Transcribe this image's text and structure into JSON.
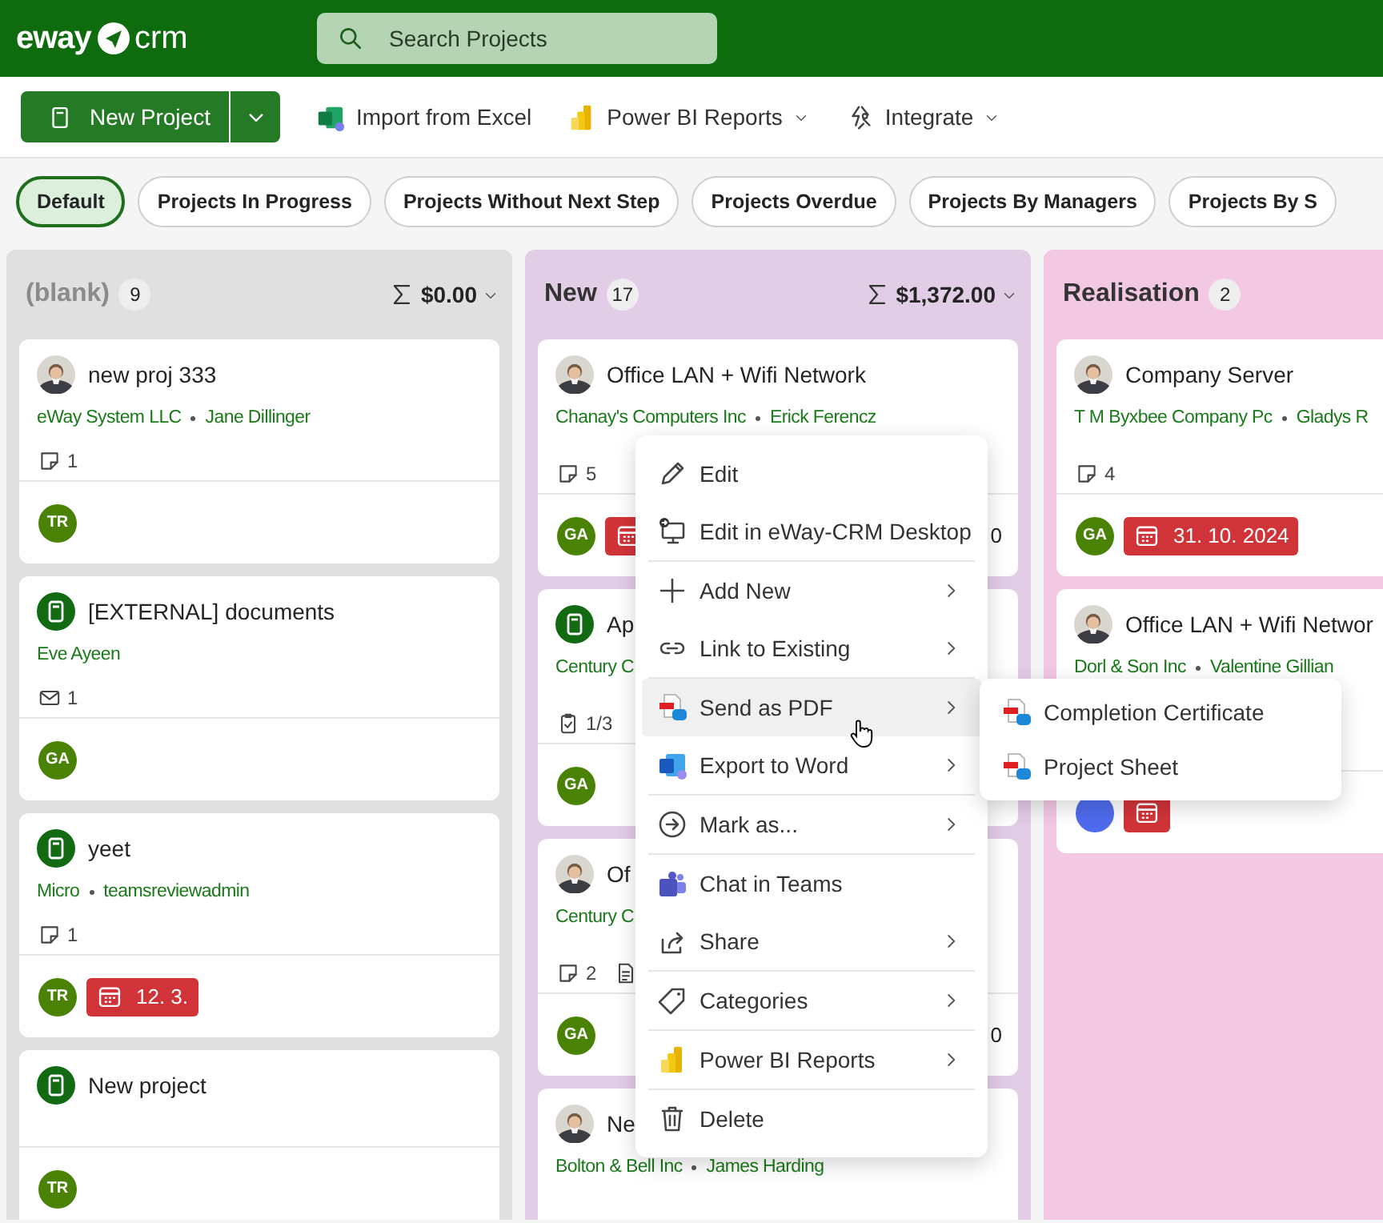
{
  "app": {
    "logo_left": "eway",
    "logo_right": "crm"
  },
  "search": {
    "placeholder": "Search Projects"
  },
  "toolbar": {
    "new_button": "New Project",
    "actions": [
      {
        "label": "Import from Excel",
        "kind": "excel",
        "dropdown": false
      },
      {
        "label": "Power BI Reports",
        "kind": "powerbi",
        "dropdown": true
      },
      {
        "label": "Integrate",
        "kind": "integrate",
        "dropdown": true
      }
    ]
  },
  "filters": [
    {
      "label": "Default",
      "selected": true
    },
    {
      "label": "Projects In Progress",
      "selected": false
    },
    {
      "label": "Projects Without Next Step",
      "selected": false
    },
    {
      "label": "Projects Overdue",
      "selected": false
    },
    {
      "label": "Projects By Managers",
      "selected": false
    },
    {
      "label": "Projects By S",
      "selected": false
    }
  ],
  "columns": [
    {
      "title": "(blank)",
      "muted": true,
      "count": "9",
      "sum": "$0.00",
      "color": "#e0e0e0",
      "cards": [
        {
          "title": "new proj 333",
          "links": [
            "eWay System LLC",
            "Jane Dillinger"
          ],
          "stats": [
            {
              "kind": "note",
              "value": "1"
            }
          ],
          "owner": {
            "initials": "TR",
            "color": "#498205"
          },
          "due_badge": false
        },
        {
          "kind": "project",
          "title": "[EXTERNAL] documents",
          "links": [
            "Eve Ayeen"
          ],
          "stats": [
            {
              "kind": "mail",
              "value": "1"
            }
          ],
          "owner": {
            "initials": "GA",
            "color": "#498205"
          },
          "due_badge": false
        },
        {
          "kind": "project",
          "title": "yeet",
          "links": [
            "Micro",
            "teamsreviewadmin"
          ],
          "stats": [
            {
              "kind": "note",
              "value": "1"
            }
          ],
          "owner": {
            "initials": "TR",
            "color": "#498205"
          },
          "due_badge": true,
          "due": "12. 3."
        },
        {
          "kind": "project",
          "title": "New project",
          "owner": {
            "initials": "TR",
            "color": "#498205"
          },
          "due_badge": false
        }
      ]
    },
    {
      "title": "New",
      "muted": false,
      "count": "17",
      "sum": "$1,372.00",
      "color": "#e2cde6",
      "cards": [
        {
          "title": "Office LAN + Wifi Network",
          "links": [
            "Chanay's Computers Inc",
            "Erick Ferencz"
          ],
          "stats": [
            {
              "kind": "note",
              "value": "5"
            }
          ],
          "owner": {
            "initials": "GA",
            "color": "#498205"
          },
          "due_badge": true,
          "amount": "0"
        },
        {
          "kind": "project",
          "title": "Ap",
          "links": [
            "Century C"
          ],
          "stats": [
            {
              "kind": "task",
              "value": "1/3"
            }
          ],
          "owner": {
            "initials": "GA",
            "color": "#498205"
          },
          "due_badge": false
        },
        {
          "title": "Of",
          "links": [
            "Century C"
          ],
          "stats": [
            {
              "kind": "note",
              "value": "2"
            },
            {
              "kind": "doc"
            }
          ],
          "owner": {
            "initials": "GA",
            "color": "#498205"
          },
          "due_badge": false,
          "amount": "0"
        },
        {
          "title": "Ne",
          "links": [
            "Bolton & Bell Inc",
            "James Harding"
          ]
        }
      ]
    },
    {
      "title": "Realisation",
      "muted": false,
      "count": "2",
      "color": "#f3c8e3",
      "cards": [
        {
          "title": "Company Server",
          "links": [
            "T M Byxbee Company Pc",
            "Gladys R"
          ],
          "stats": [
            {
              "kind": "note",
              "value": "4"
            }
          ],
          "owner": {
            "initials": "GA",
            "color": "#498205"
          },
          "due_badge": true,
          "due": "31. 10. 2024"
        },
        {
          "title": "Office LAN + Wifi Networ",
          "links": [
            "Dorl & Son Inc",
            "Valentine Gillian"
          ],
          "owner": {
            "color": "#4f6bed"
          },
          "due_badge": true
        }
      ]
    }
  ],
  "context_menu": {
    "groups": [
      [
        {
          "label": "Edit",
          "kind": "edit",
          "submenu": false,
          "selected": false
        },
        {
          "label": "Edit in eWay-CRM Desktop",
          "kind": "desktop",
          "submenu": false,
          "selected": false
        }
      ],
      [
        {
          "label": "Add New",
          "kind": "add",
          "submenu": true,
          "selected": false
        },
        {
          "label": "Link to Existing",
          "kind": "link",
          "submenu": true,
          "selected": false
        }
      ],
      [
        {
          "label": "Send as PDF",
          "kind": "pdf",
          "submenu": true,
          "selected": true
        },
        {
          "label": "Export to Word",
          "kind": "word",
          "submenu": true,
          "selected": false
        }
      ],
      [
        {
          "label": "Mark as...",
          "kind": "mark",
          "submenu": true,
          "selected": false
        }
      ],
      [
        {
          "label": "Chat in Teams",
          "kind": "teams",
          "submenu": false,
          "selected": false
        },
        {
          "label": "Share",
          "kind": "share",
          "submenu": true,
          "selected": false
        }
      ],
      [
        {
          "label": "Categories",
          "kind": "tag",
          "submenu": true,
          "selected": false
        }
      ],
      [
        {
          "label": "Power BI Reports",
          "kind": "powerbi",
          "submenu": true,
          "selected": false
        }
      ],
      [
        {
          "label": "Delete",
          "kind": "delete",
          "submenu": false,
          "selected": false
        }
      ]
    ]
  },
  "submenu": {
    "items": [
      {
        "label": "Completion Certificate",
        "kind": "pdf"
      },
      {
        "label": "Project Sheet",
        "kind": "pdf"
      }
    ]
  }
}
